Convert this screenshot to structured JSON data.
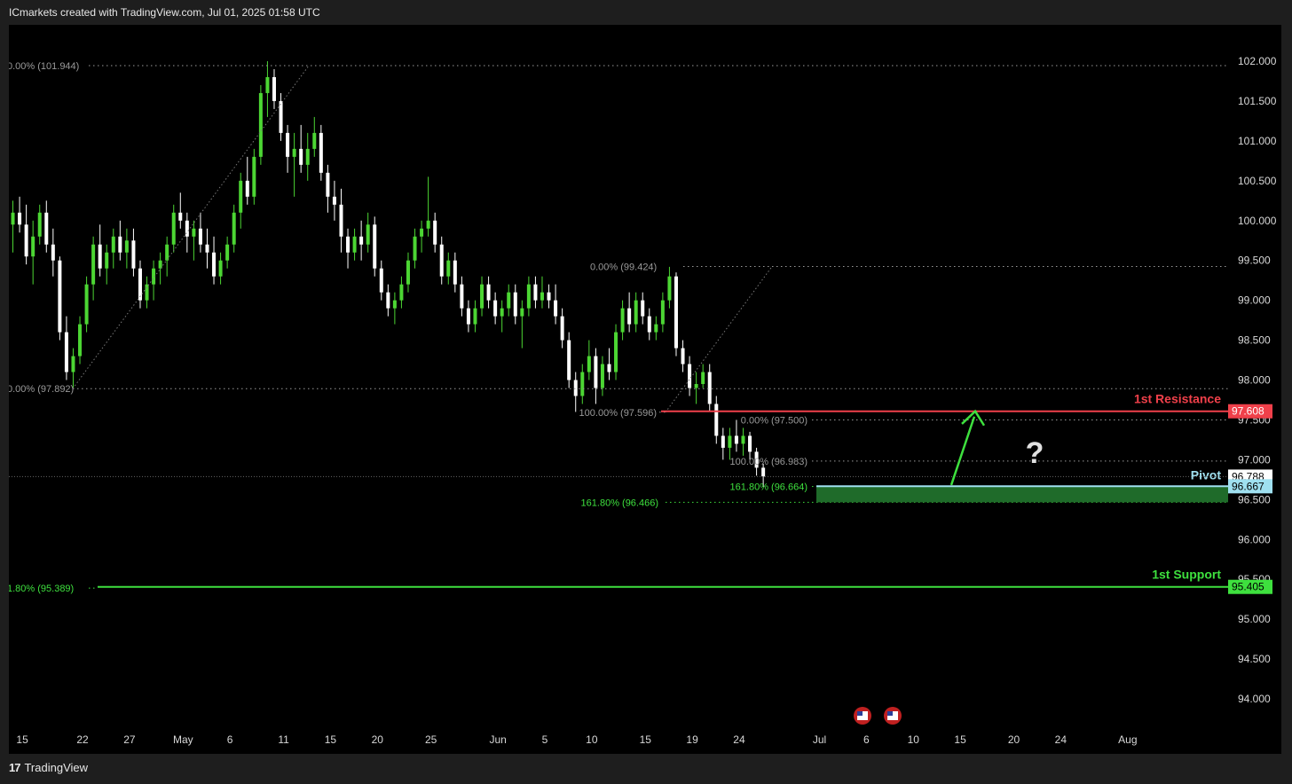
{
  "header": {
    "title": "ICmarkets created with TradingView.com, Jul 01, 2025 01:58 UTC"
  },
  "footer": {
    "brand": "TradingView",
    "logo_text": "17"
  },
  "colors": {
    "background": "#000000",
    "up_candle": "#4cd633",
    "down_candle": "#ffffff",
    "resistance": "#f0404a",
    "support": "#3ee03e",
    "pivot": "#9fe0f0",
    "arrow": "#3ee03e",
    "zone_fill": "#1f6b2a"
  },
  "chart_data": {
    "type": "candlestick",
    "ylim": [
      93.7,
      102.2
    ],
    "y_ticks": [
      "102.000",
      "101.500",
      "101.000",
      "100.500",
      "100.000",
      "99.500",
      "99.000",
      "98.500",
      "98.000",
      "97.500",
      "97.000",
      "96.500",
      "96.000",
      "95.500",
      "95.000",
      "94.500",
      "94.000"
    ],
    "y_tick_values": [
      102.0,
      101.5,
      101.0,
      100.5,
      100.0,
      99.5,
      99.0,
      98.5,
      98.0,
      97.5,
      97.0,
      96.5,
      96.0,
      95.5,
      95.0,
      94.5,
      94.0
    ],
    "x_ticks": [
      "15",
      "22",
      "27",
      "May",
      "6",
      "11",
      "15",
      "20",
      "25",
      "Jun",
      "5",
      "10",
      "15",
      "19",
      "24",
      "Jul",
      "6",
      "10",
      "15",
      "20",
      "24",
      "Aug"
    ],
    "x_tick_index": [
      2,
      11,
      18,
      26,
      33,
      41,
      48,
      55,
      63,
      73,
      80,
      87,
      95,
      102,
      109,
      121,
      128,
      135,
      142,
      150,
      157,
      167
    ],
    "candles": [
      [
        99.95,
        100.25,
        99.6,
        100.1
      ],
      [
        100.1,
        100.3,
        99.85,
        99.95
      ],
      [
        99.95,
        100.2,
        99.45,
        99.55
      ],
      [
        99.55,
        100.0,
        99.2,
        99.8
      ],
      [
        99.8,
        100.2,
        99.7,
        100.1
      ],
      [
        100.1,
        100.25,
        99.6,
        99.7
      ],
      [
        99.7,
        99.9,
        99.3,
        99.5
      ],
      [
        99.5,
        99.55,
        98.5,
        98.6
      ],
      [
        98.6,
        98.8,
        98.0,
        98.1
      ],
      [
        98.1,
        98.4,
        97.9,
        98.3
      ],
      [
        98.3,
        98.8,
        98.2,
        98.7
      ],
      [
        98.7,
        99.3,
        98.6,
        99.2
      ],
      [
        99.2,
        99.8,
        99.0,
        99.7
      ],
      [
        99.7,
        99.95,
        99.3,
        99.4
      ],
      [
        99.4,
        99.7,
        99.2,
        99.6
      ],
      [
        99.6,
        99.9,
        99.4,
        99.8
      ],
      [
        99.8,
        100.0,
        99.5,
        99.6
      ],
      [
        99.6,
        99.9,
        99.4,
        99.75
      ],
      [
        99.75,
        99.9,
        99.3,
        99.4
      ],
      [
        99.4,
        99.5,
        98.9,
        99.0
      ],
      [
        99.0,
        99.3,
        98.9,
        99.2
      ],
      [
        99.2,
        99.5,
        99.0,
        99.4
      ],
      [
        99.4,
        99.6,
        99.2,
        99.5
      ],
      [
        99.5,
        99.8,
        99.3,
        99.7
      ],
      [
        99.7,
        100.2,
        99.6,
        100.1
      ],
      [
        100.1,
        100.35,
        99.9,
        100.0
      ],
      [
        100.0,
        100.1,
        99.6,
        99.8
      ],
      [
        99.8,
        100.0,
        99.5,
        99.9
      ],
      [
        99.9,
        100.1,
        99.6,
        99.7
      ],
      [
        99.7,
        99.9,
        99.4,
        99.6
      ],
      [
        99.6,
        99.8,
        99.2,
        99.3
      ],
      [
        99.3,
        99.6,
        99.2,
        99.5
      ],
      [
        99.5,
        99.8,
        99.4,
        99.7
      ],
      [
        99.7,
        100.2,
        99.6,
        100.1
      ],
      [
        100.1,
        100.6,
        99.9,
        100.5
      ],
      [
        100.5,
        100.8,
        100.2,
        100.3
      ],
      [
        100.3,
        100.9,
        100.2,
        100.8
      ],
      [
        100.8,
        101.7,
        100.7,
        101.6
      ],
      [
        101.6,
        102.0,
        101.3,
        101.8
      ],
      [
        101.8,
        101.9,
        101.4,
        101.5
      ],
      [
        101.5,
        101.6,
        101.0,
        101.1
      ],
      [
        101.1,
        101.2,
        100.6,
        100.8
      ],
      [
        100.8,
        101.1,
        100.3,
        100.9
      ],
      [
        100.9,
        101.2,
        100.6,
        100.7
      ],
      [
        100.7,
        101.1,
        100.5,
        100.9
      ],
      [
        100.9,
        101.3,
        100.8,
        101.1
      ],
      [
        101.1,
        101.2,
        100.5,
        100.6
      ],
      [
        100.6,
        100.7,
        100.1,
        100.3
      ],
      [
        100.3,
        100.5,
        100.0,
        100.2
      ],
      [
        100.2,
        100.4,
        99.6,
        99.8
      ],
      [
        99.8,
        99.9,
        99.4,
        99.6
      ],
      [
        99.6,
        99.9,
        99.5,
        99.8
      ],
      [
        99.8,
        100.0,
        99.5,
        99.7
      ],
      [
        99.7,
        100.1,
        99.6,
        99.95
      ],
      [
        99.95,
        100.05,
        99.3,
        99.4
      ],
      [
        99.4,
        99.5,
        99.0,
        99.1
      ],
      [
        99.1,
        99.2,
        98.8,
        98.9
      ],
      [
        98.9,
        99.1,
        98.7,
        99.0
      ],
      [
        99.0,
        99.3,
        98.9,
        99.2
      ],
      [
        99.2,
        99.6,
        99.1,
        99.5
      ],
      [
        99.5,
        99.9,
        99.4,
        99.8
      ],
      [
        99.8,
        100.0,
        99.6,
        99.9
      ],
      [
        99.9,
        100.55,
        99.8,
        100.0
      ],
      [
        100.0,
        100.1,
        99.6,
        99.7
      ],
      [
        99.7,
        99.8,
        99.2,
        99.3
      ],
      [
        99.3,
        99.6,
        99.2,
        99.5
      ],
      [
        99.5,
        99.6,
        99.1,
        99.2
      ],
      [
        99.2,
        99.3,
        98.8,
        98.9
      ],
      [
        98.9,
        99.0,
        98.6,
        98.7
      ],
      [
        98.7,
        99.0,
        98.6,
        98.9
      ],
      [
        98.9,
        99.3,
        98.8,
        99.2
      ],
      [
        99.2,
        99.3,
        98.9,
        99.0
      ],
      [
        99.0,
        99.1,
        98.7,
        98.8
      ],
      [
        98.8,
        99.0,
        98.6,
        98.9
      ],
      [
        98.9,
        99.2,
        98.8,
        99.1
      ],
      [
        99.1,
        99.2,
        98.7,
        98.8
      ],
      [
        98.8,
        99.0,
        98.4,
        98.9
      ],
      [
        98.9,
        99.3,
        98.8,
        99.2
      ],
      [
        99.2,
        99.3,
        98.9,
        99.0
      ],
      [
        99.0,
        99.3,
        98.9,
        99.1
      ],
      [
        99.1,
        99.2,
        98.9,
        99.0
      ],
      [
        99.0,
        99.2,
        98.7,
        98.8
      ],
      [
        98.8,
        98.9,
        98.4,
        98.5
      ],
      [
        98.5,
        98.6,
        97.9,
        98.0
      ],
      [
        98.0,
        98.1,
        97.6,
        97.8
      ],
      [
        97.8,
        98.2,
        97.7,
        98.1
      ],
      [
        98.1,
        98.5,
        98.0,
        98.3
      ],
      [
        98.3,
        98.4,
        97.7,
        97.9
      ],
      [
        97.9,
        98.3,
        97.8,
        98.2
      ],
      [
        98.2,
        98.4,
        98.0,
        98.1
      ],
      [
        98.1,
        98.7,
        98.0,
        98.6
      ],
      [
        98.6,
        99.0,
        98.5,
        98.9
      ],
      [
        98.9,
        99.1,
        98.6,
        98.7
      ],
      [
        98.7,
        99.1,
        98.6,
        99.0
      ],
      [
        99.0,
        99.1,
        98.7,
        98.8
      ],
      [
        98.8,
        98.9,
        98.5,
        98.6
      ],
      [
        98.6,
        98.8,
        98.5,
        98.7
      ],
      [
        98.7,
        99.1,
        98.6,
        99.0
      ],
      [
        99.0,
        99.42,
        98.9,
        99.3
      ],
      [
        99.3,
        99.35,
        98.3,
        98.4
      ],
      [
        98.4,
        98.5,
        98.1,
        98.2
      ],
      [
        98.2,
        98.3,
        97.8,
        97.9
      ],
      [
        97.9,
        98.1,
        97.7,
        97.95
      ],
      [
        97.95,
        98.2,
        97.9,
        98.1
      ],
      [
        98.1,
        98.2,
        97.6,
        97.7
      ],
      [
        97.7,
        97.8,
        97.2,
        97.3
      ],
      [
        97.3,
        97.4,
        97.0,
        97.15
      ],
      [
        97.15,
        97.4,
        97.0,
        97.3
      ],
      [
        97.3,
        97.5,
        97.1,
        97.2
      ],
      [
        97.2,
        97.4,
        97.05,
        97.3
      ],
      [
        97.3,
        97.35,
        97.0,
        97.1
      ],
      [
        97.1,
        97.15,
        96.8,
        96.9
      ],
      [
        96.9,
        96.95,
        96.66,
        96.79
      ]
    ]
  },
  "annotations": {
    "fib_labels": [
      {
        "text": "0.00% (101.944)",
        "value": 101.944,
        "color": "#9a9a9a"
      },
      {
        "text": "0.00% (97.892)",
        "value": 97.892,
        "color": "#9a9a9a"
      },
      {
        "text": "0.00% (99.424)",
        "value": 99.424,
        "color": "#9a9a9a"
      },
      {
        "text": "100.00% (97.596)",
        "value": 97.596,
        "color": "#9a9a9a"
      },
      {
        "text": "0.00% (97.500)",
        "value": 97.5,
        "color": "#9a9a9a"
      },
      {
        "text": "100.00% (96.983)",
        "value": 96.983,
        "color": "#9a9a9a"
      },
      {
        "text": "161.80% (96.664)",
        "value": 96.664,
        "color": "#3ee03e"
      },
      {
        "text": "161.80% (96.466)",
        "value": 96.466,
        "color": "#3ee03e"
      },
      {
        "text": "1.80% (95.389)",
        "value": 95.389,
        "color": "#3ee03e"
      }
    ],
    "resistance": {
      "label": "1st Resistance",
      "value": 97.608,
      "price_tag": "97.608"
    },
    "pivot": {
      "label": "Pivot",
      "value": 96.667,
      "price_tag": "96.667"
    },
    "support": {
      "label": "1st Support",
      "value": 95.405,
      "price_tag": "95.405"
    },
    "current_price": {
      "value": 96.788,
      "price_tag": "96.788"
    },
    "question_mark": "?",
    "event_flags": [
      "us-flag",
      "us-flag"
    ]
  }
}
